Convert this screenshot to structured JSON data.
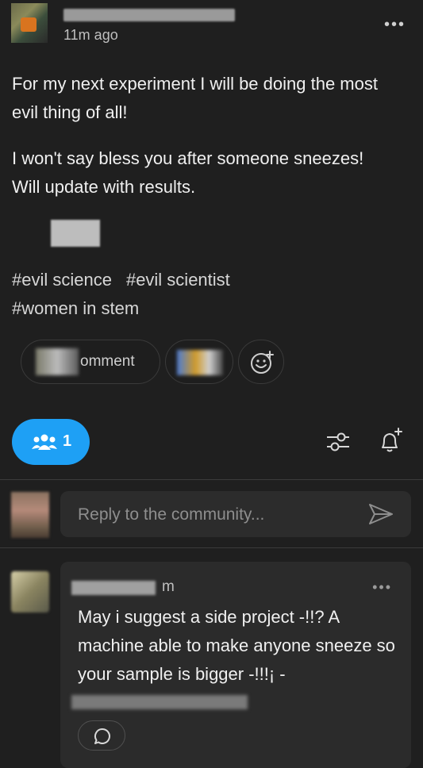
{
  "post": {
    "time": "11m ago",
    "more_label": "•••",
    "paragraphs": [
      "For my next experiment I will be doing the most evil thing of all!",
      "I won't say bless you after someone sneezes! Will update with results."
    ],
    "tags": [
      "#evil science",
      "#evil scientist",
      "#women in stem"
    ]
  },
  "actions": {
    "comment_label": "omment",
    "reblog_icon": "reblog-icon",
    "emoji_icon": "emoji-add-icon"
  },
  "community": {
    "members_count": "1",
    "members_icon": "people-icon",
    "filter_icon": "filter-sliders-icon",
    "bell_icon": "bell-add-icon",
    "accent": "#1ea0f5"
  },
  "reply": {
    "placeholder": "Reply to the community...",
    "send_icon": "send-icon"
  },
  "comment": {
    "time": "m",
    "more_label": "•••",
    "text": "May i suggest a side project -!!? A machine able to make anyone sneeze so your sample is bigger -!!!¡ -",
    "reply_icon": "speech-bubble-icon"
  }
}
